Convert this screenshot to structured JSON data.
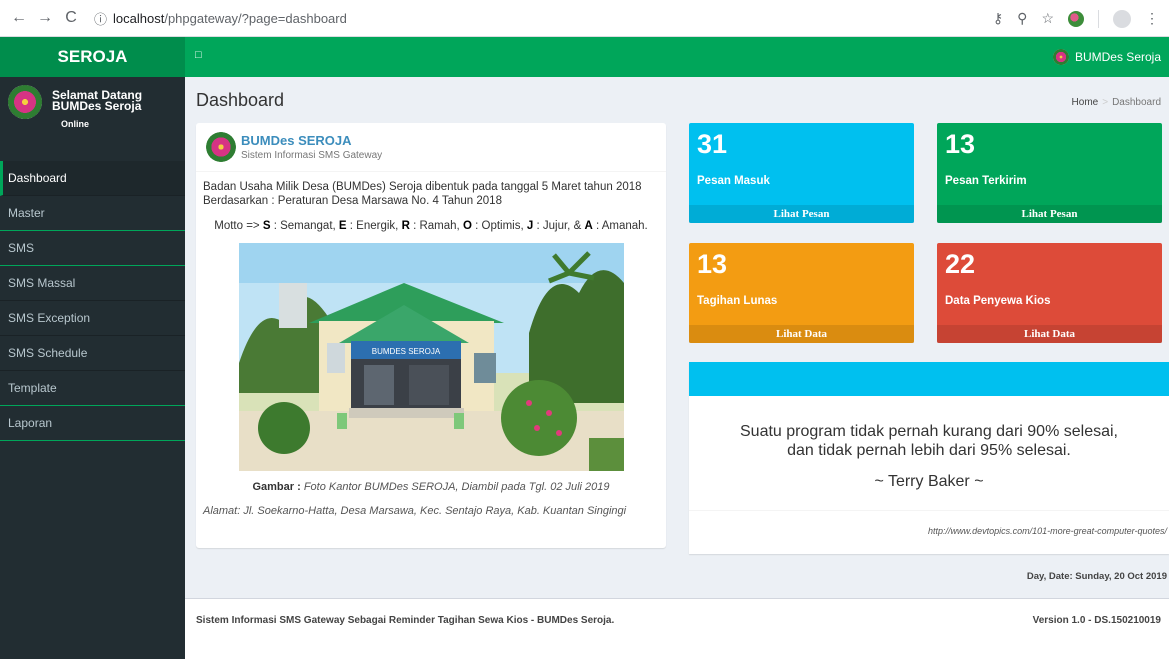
{
  "browser": {
    "url_host": "localhost",
    "url_path": "/phpgateway/?page=dashboard"
  },
  "app": {
    "logo": "SEROJA",
    "toggle_icon": "□",
    "user_label": "BUMDes Seroja"
  },
  "sidebar": {
    "user_name_line1": "Selamat Datang",
    "user_name_line2": "BUMDes Seroja",
    "status": "Online",
    "items": [
      {
        "label": "Dashboard"
      },
      {
        "label": "Master"
      },
      {
        "label": "SMS"
      },
      {
        "label": "SMS Massal"
      },
      {
        "label": "SMS Exception"
      },
      {
        "label": "SMS Schedule"
      },
      {
        "label": "Template"
      },
      {
        "label": "Laporan"
      }
    ]
  },
  "header": {
    "title": "Dashboard",
    "breadcrumb_home": "Home",
    "breadcrumb_sep": ">",
    "breadcrumb_current": "Dashboard"
  },
  "profile": {
    "title": "BUMDes SEROJA",
    "subtitle": "Sistem Informasi SMS Gateway",
    "desc_line1": "Badan Usaha Milik Desa (BUMDes) Seroja dibentuk pada tanggal 5 Maret tahun 2018",
    "desc_line2": "Berdasarkan : Peraturan Desa Marsawa No. 4 Tahun 2018",
    "motto_prefix": "Motto =>",
    "motto_s": "S",
    "motto_s_text": ": Semangat,",
    "motto_e": "E",
    "motto_e_text": ": Energik,",
    "motto_r": "R",
    "motto_r_text": ": Ramah,",
    "motto_o": "O",
    "motto_o_text": ": Optimis,",
    "motto_j": "J",
    "motto_j_text": ": Jujur, &",
    "motto_a": "A",
    "motto_a_text": ": Amanah.",
    "photo_sign": "BUMDES SEROJA",
    "caption_label": "Gambar :",
    "caption_text": "Foto Kantor BUMDes SEROJA, Diambil pada Tgl. 02 Juli 2019",
    "address": "Alamat: Jl. Soekarno-Hatta, Desa Marsawa, Kec. Sentajo Raya, Kab. Kuantan Singingi"
  },
  "stats": [
    {
      "value": "31",
      "label": "Pesan Masuk",
      "link": "Lihat Pesan",
      "color": "#00c0ef"
    },
    {
      "value": "13",
      "label": "Pesan Terkirim",
      "link": "Lihat Pesan",
      "color": "#00a65a"
    },
    {
      "value": "13",
      "label": "Tagihan Lunas",
      "link": "Lihat Data",
      "color": "#f39c12"
    },
    {
      "value": "22",
      "label": "Data Penyewa Kios",
      "link": "Lihat Data",
      "color": "#dd4b39"
    }
  ],
  "quote": {
    "line1": "Suatu program tidak pernah kurang dari 90% selesai,",
    "line2": "dan tidak pernah lebih dari 95% selesai.",
    "author": "~ Terry Baker ~",
    "source": "http://www.devtopics.com/101-more-great-computer-quotes/"
  },
  "date_text": "Day, Date: Sunday, 20 Oct 2019",
  "footer": {
    "left": "Sistem Informasi SMS Gateway Sebagai Reminder Tagihan Sewa Kios - BUMDes Seroja.",
    "right": "Version 1.0 - DS.150210019"
  }
}
